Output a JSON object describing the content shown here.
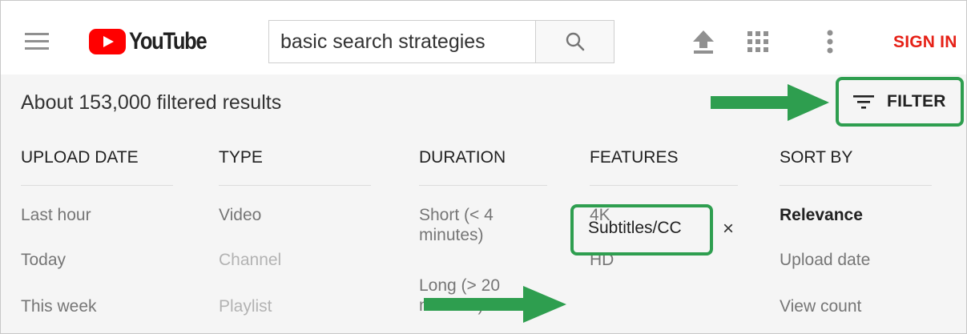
{
  "header": {
    "logo_text": "YouTube",
    "search": {
      "value": "basic search strategies"
    },
    "sign_in_label": "SIGN IN"
  },
  "filter_bar": {
    "results_count": "About 153,000 filtered results",
    "filter_label": "FILTER",
    "columns": [
      {
        "header": "UPLOAD DATE",
        "options": [
          "Last hour",
          "Today",
          "This week"
        ]
      },
      {
        "header": "TYPE",
        "options": [
          "Video",
          "Channel",
          "Playlist"
        ]
      },
      {
        "header": "DURATION",
        "options": [
          "Short (< 4 minutes)",
          "Long (> 20 minutes)"
        ]
      },
      {
        "header": "FEATURES",
        "options": [
          "4K",
          "HD",
          "Subtitles/CC"
        ]
      },
      {
        "header": "SORT BY",
        "options": [
          "Relevance",
          "Upload date",
          "View count"
        ]
      }
    ],
    "remove_filter_glyph": "×"
  },
  "colors": {
    "youtube_red": "#ff0000",
    "sign_in_red": "#e62117",
    "annotation_green": "#2e9e4f"
  },
  "icons": [
    "hamburger-menu-icon",
    "youtube-play-icon",
    "search-icon",
    "upload-icon",
    "apps-grid-icon",
    "more-vert-icon",
    "filter-icon",
    "close-icon",
    "arrow-right-icon"
  ]
}
